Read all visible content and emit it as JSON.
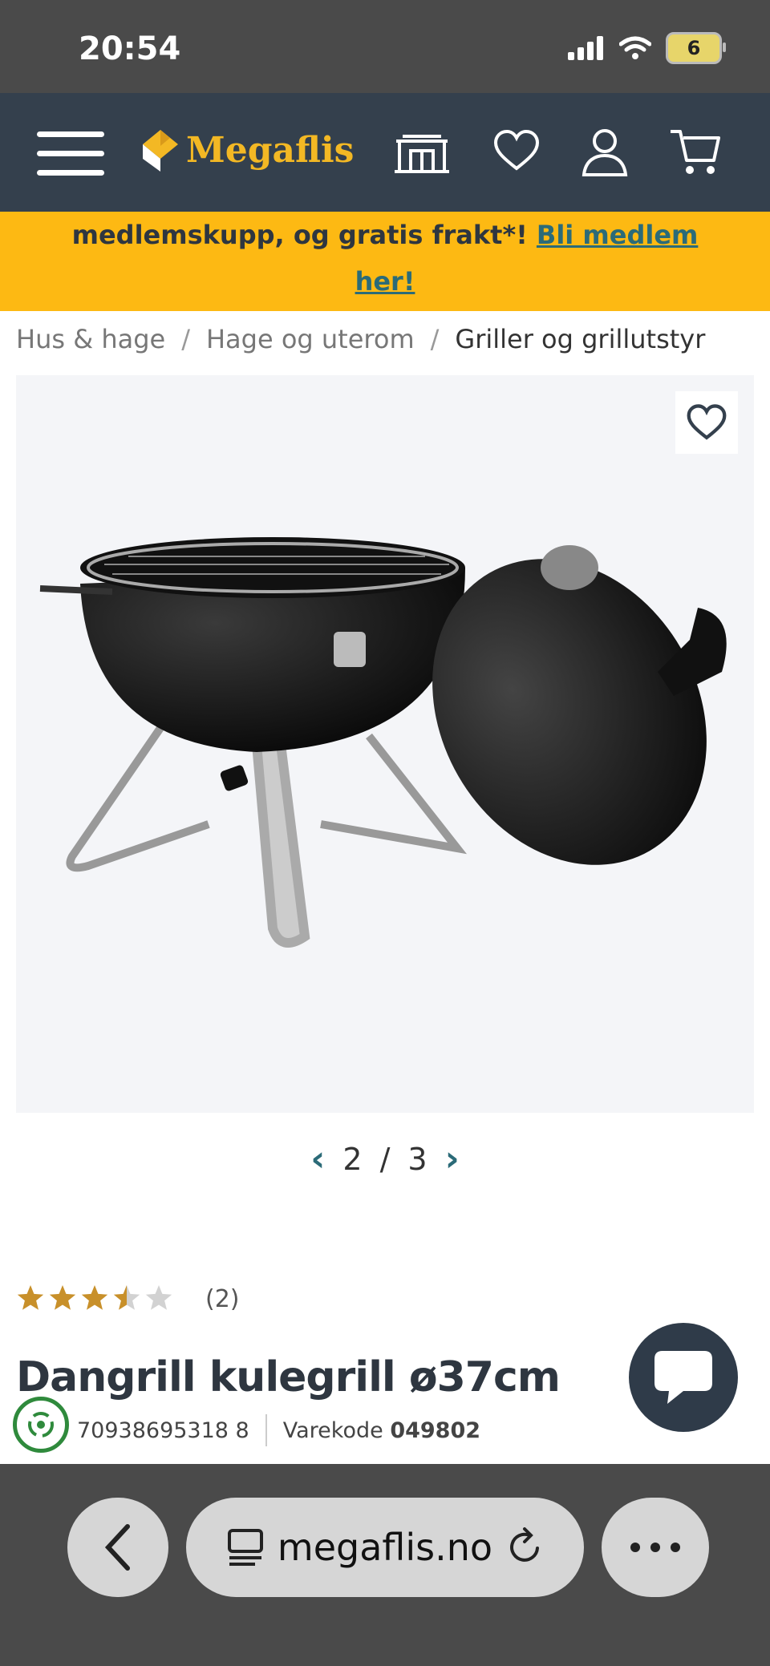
{
  "status_bar": {
    "time": "20:54",
    "battery": "6"
  },
  "nav": {
    "logo_text": "Megaflis"
  },
  "promo": {
    "text": "medlemskupp, og gratis frakt*! ",
    "link_line1": "Bli medlem",
    "link_line2": "her!"
  },
  "breadcrumb": [
    "Hus & hage",
    "Hage og uterom",
    "Griller og grillutstyr"
  ],
  "gallery": {
    "current": "2",
    "separator": "/",
    "total": "3"
  },
  "rating": {
    "stars": 3.5,
    "max": 5,
    "count": "(2)"
  },
  "product": {
    "title": "Dangrill kulegrill ø37cm",
    "ean": "70938695318 8",
    "code_label": "Varekode",
    "code": "049802"
  },
  "browser": {
    "url": "megaflis.no"
  },
  "colors": {
    "nav_bg": "#34404d",
    "promo_bg": "#fdb913",
    "accent": "#2b6b78",
    "star": "#c8902a"
  }
}
